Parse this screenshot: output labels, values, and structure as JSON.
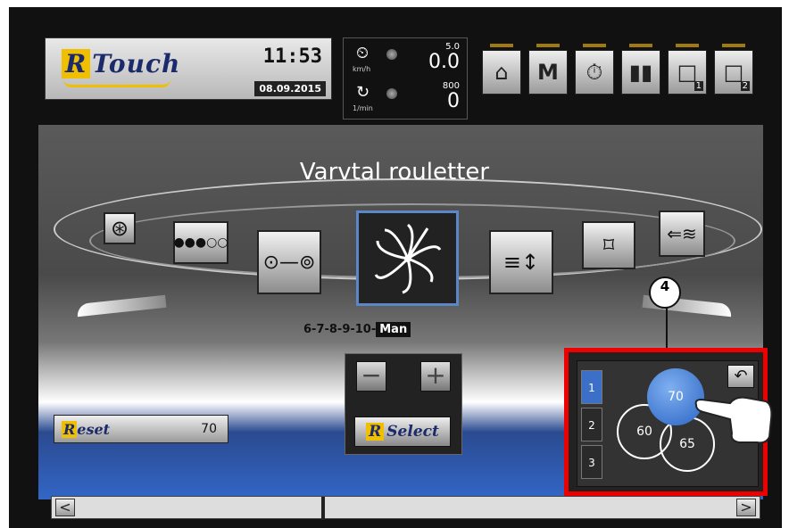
{
  "header": {
    "logo_text": "Touch",
    "logo_letter": "R",
    "time": "11:53",
    "date": "08.09.2015"
  },
  "gauges": {
    "speed": {
      "unit": "km/h",
      "setpoint": "5.0",
      "value": "0.0"
    },
    "rpm": {
      "unit": "1/min",
      "setpoint": "800",
      "value": "0"
    }
  },
  "nav": {
    "items": [
      {
        "icon": "home-icon"
      },
      {
        "icon": "m-icon"
      },
      {
        "icon": "stopwatch-icon"
      },
      {
        "icon": "bar-chart-icon"
      },
      {
        "icon": "page-1-icon",
        "badge": "1"
      },
      {
        "icon": "page-2-icon",
        "badge": "2"
      }
    ]
  },
  "main": {
    "title": "Varvtal rouletter",
    "sequence": {
      "prefix": "6-7-8-9-10-",
      "selected": "Man"
    },
    "reset": {
      "label": "eset",
      "letter": "R",
      "value": "70"
    },
    "select": {
      "label": "Select",
      "letter": "R"
    },
    "minus": "−",
    "plus": "+"
  },
  "roulette_panel": {
    "callout": "4",
    "tabs": [
      "1",
      "2",
      "3"
    ],
    "active_tab": "1",
    "speeds": [
      "70",
      "60",
      "65"
    ],
    "active_speed": "70"
  },
  "slider": {
    "left": "<",
    "right": ">"
  },
  "colors": {
    "accent": "#3b6fc8",
    "highlight": "#e00000",
    "brand": "#f0c000"
  }
}
